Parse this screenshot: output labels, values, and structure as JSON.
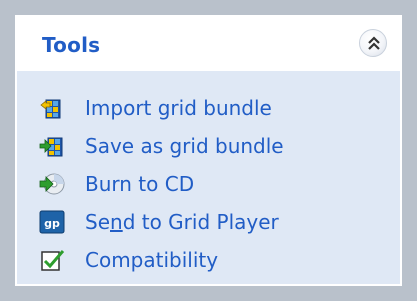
{
  "panel": {
    "title": "Tools",
    "collapse_icon": "chevrons-up-icon",
    "accent_color": "#215dc6",
    "background_color": "#dfe8f5"
  },
  "tasks": [
    {
      "label": "Import grid bundle",
      "icon": "import-bundle-icon"
    },
    {
      "label": "Save as grid bundle",
      "icon": "save-bundle-icon"
    },
    {
      "label": "Burn to CD",
      "icon": "burn-cd-icon"
    },
    {
      "label_before": "Se",
      "label_mnemonic": "n",
      "label_after": "d to Grid Player",
      "icon": "grid-player-icon",
      "icon_text": "gp"
    },
    {
      "label": "Compatibility",
      "icon": "compatibility-check-icon"
    }
  ]
}
